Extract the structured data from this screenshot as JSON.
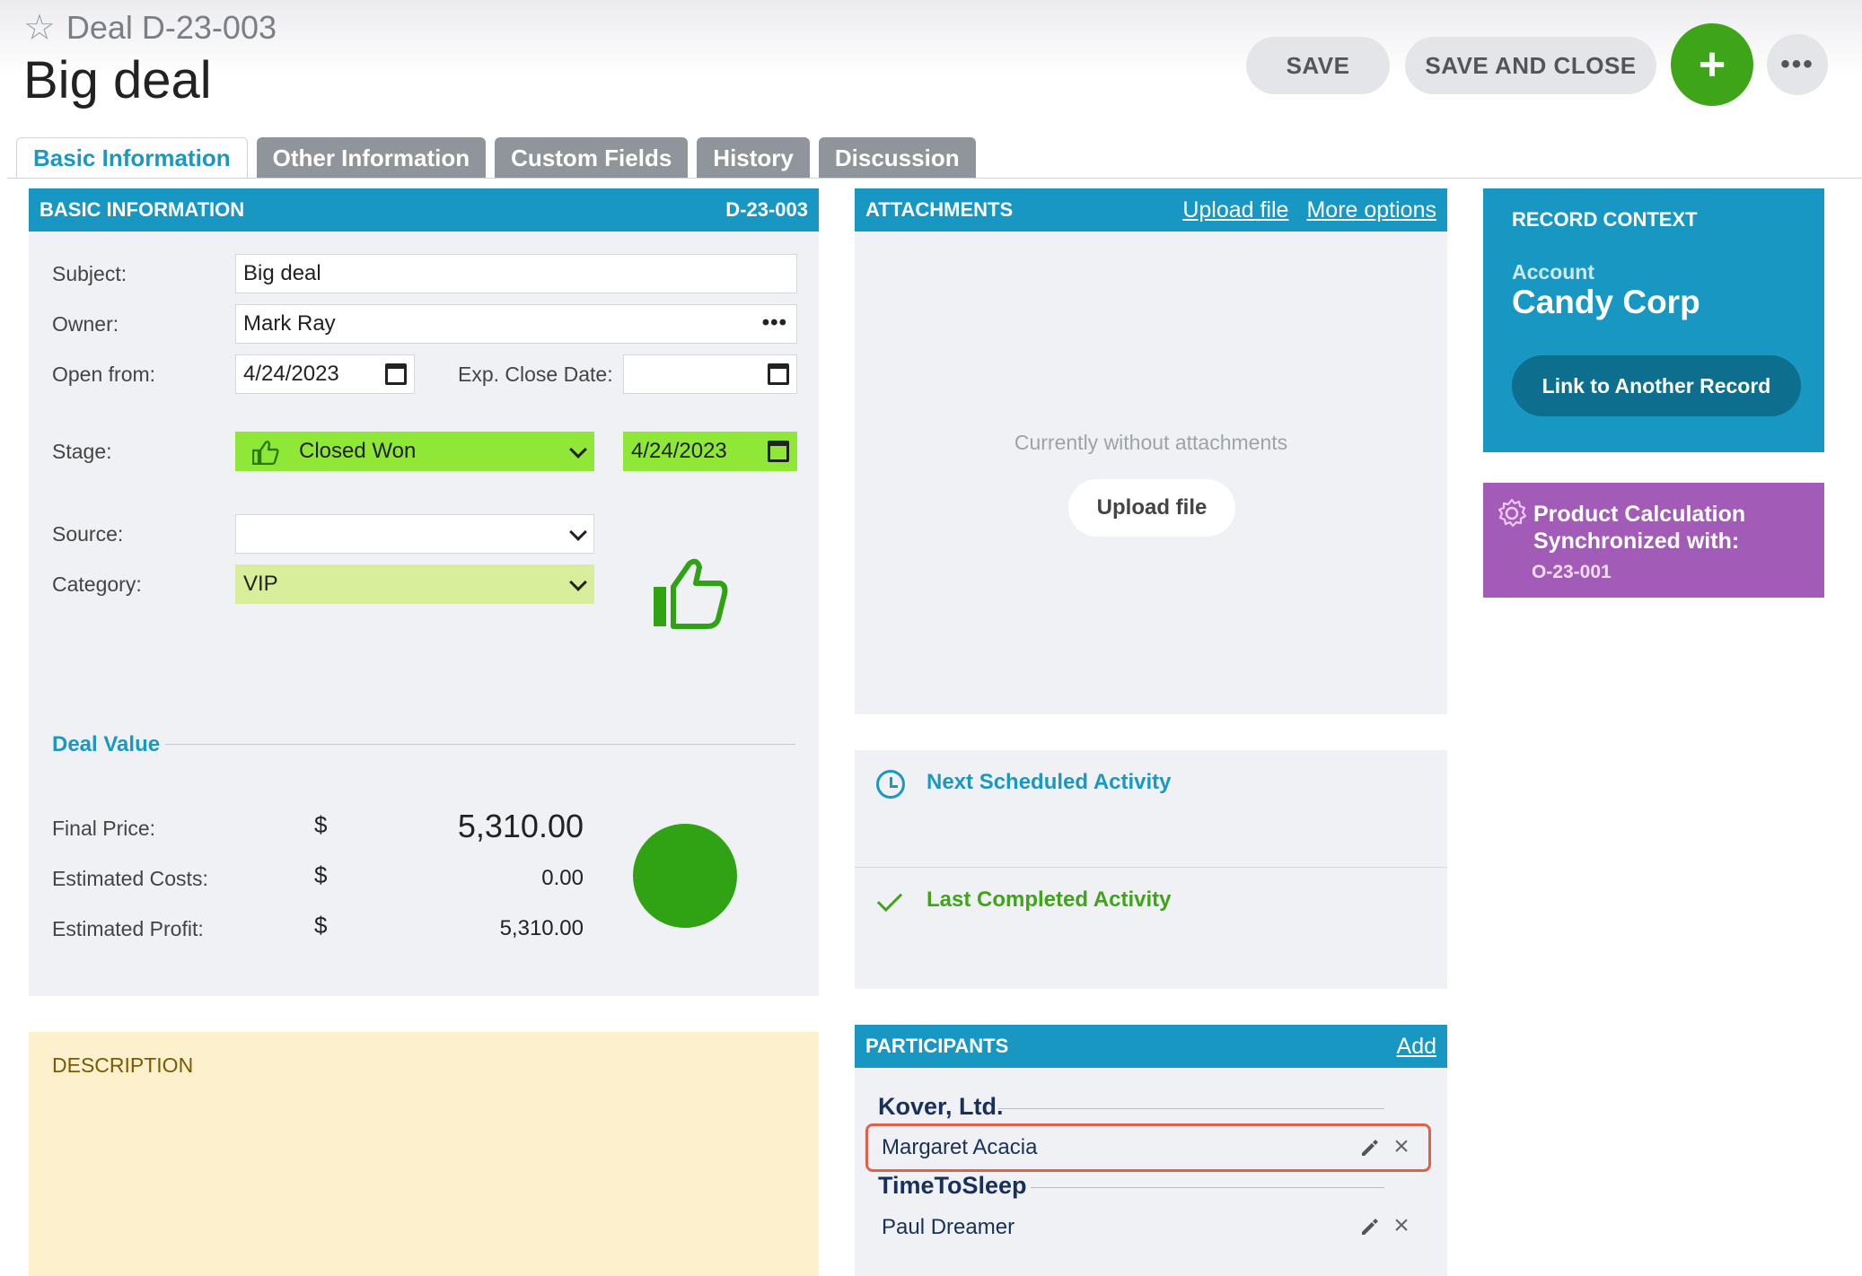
{
  "header": {
    "record_label": "Deal D-23-003",
    "title": "Big deal",
    "save_label": "SAVE",
    "save_close_label": "SAVE AND CLOSE",
    "add_label": "+",
    "more_label": "•••"
  },
  "tabs": [
    {
      "label": "Basic Information",
      "active": true
    },
    {
      "label": "Other Information",
      "active": false
    },
    {
      "label": "Custom Fields",
      "active": false
    },
    {
      "label": "History",
      "active": false
    },
    {
      "label": "Discussion",
      "active": false
    }
  ],
  "basic": {
    "heading": "BASIC INFORMATION",
    "record_id": "D-23-003",
    "subject_label": "Subject:",
    "subject_value": "Big deal",
    "owner_label": "Owner:",
    "owner_value": "Mark Ray",
    "owner_more": "•••",
    "open_from_label": "Open from:",
    "open_from_value": "4/24/2023",
    "exp_close_label": "Exp. Close Date:",
    "exp_close_value": "",
    "stage_label": "Stage:",
    "stage_value": "Closed Won",
    "stage_date": "4/24/2023",
    "source_label": "Source:",
    "source_value": "",
    "category_label": "Category:",
    "category_value": "VIP",
    "stage_color": "#8fe838",
    "category_color": "#d8ee9a"
  },
  "deal_value": {
    "heading": "Deal Value",
    "currency": "$",
    "final_price_label": "Final Price:",
    "final_price": "5,310.00",
    "est_costs_label": "Estimated Costs:",
    "est_costs": "0.00",
    "est_profit_label": "Estimated Profit:",
    "est_profit": "5,310.00",
    "status_color": "#2fa313"
  },
  "description": {
    "label": "DESCRIPTION"
  },
  "attachments": {
    "heading": "ATTACHMENTS",
    "upload_link": "Upload file",
    "more_link": "More options",
    "empty_text": "Currently without attachments",
    "upload_button": "Upload file"
  },
  "activities": {
    "next_label": "Next Scheduled Activity",
    "last_label": "Last Completed Activity"
  },
  "participants": {
    "heading": "PARTICIPANTS",
    "add_link": "Add",
    "groups": [
      {
        "org": "Kover, Ltd.",
        "person": "Margaret Acacia"
      },
      {
        "org": "TimeToSleep",
        "person": "Paul Dreamer"
      }
    ]
  },
  "context": {
    "heading": "RECORD CONTEXT",
    "account_label": "Account",
    "account_name": "Candy Corp",
    "link_button": "Link to Another Record"
  },
  "product_calc": {
    "title_line1": "Product Calculation",
    "title_line2": "Synchronized with:",
    "linked_id": "O-23-001"
  },
  "colors": {
    "accent": "#1797c2",
    "add_button": "#3fa518",
    "product_calc_bg": "#a25bb7",
    "description_bg": "#fdf0cd"
  }
}
